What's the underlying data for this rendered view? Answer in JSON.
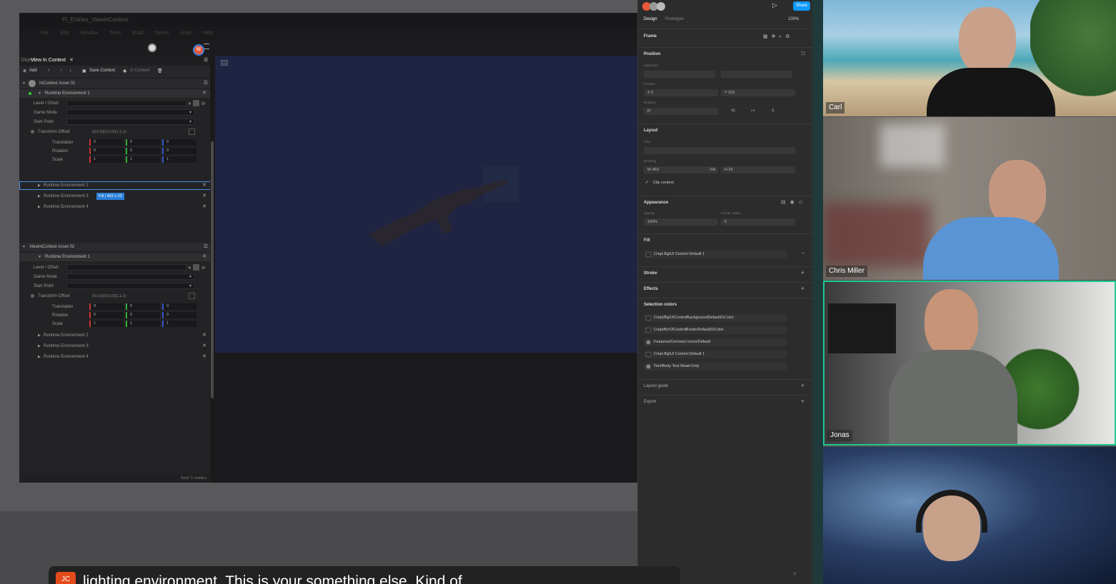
{
  "colors": {
    "accent": "#2a7fd8",
    "teal_border": "#1fc890",
    "figma_share": "#0d99ff",
    "caption_logo": "#e44a1a"
  },
  "editor": {
    "title": "FI_Entries_ViewInContext",
    "menu": "File Edit Window Tools Build Select Actor Help",
    "tab": {
      "left": "Object",
      "label": "View In Context"
    },
    "toolbar": {
      "add": "Add",
      "save": "Save Context",
      "incontext": "In Context"
    },
    "avatar_initial": "M",
    "assets": [
      {
        "name": "InContext Asset 01",
        "env1": "Runtime Environment 1",
        "fields": {
          "level": "Level / OSub",
          "game_mode": "Game Mode",
          "start_point": "Start Point",
          "transform": "Transform Offset",
          "transform_val": "(0,0,0)(0,0,0)(1,1,1)"
        },
        "translation": {
          "label": "Translation",
          "x": "0",
          "y": "0",
          "z": "0"
        },
        "rotation": {
          "label": "Rotation",
          "x": "0",
          "y": "0",
          "z": "0"
        },
        "scale": {
          "label": "Scale",
          "x": "1",
          "y": "1",
          "z": "1"
        },
        "envs": [
          "Runtime Environment 2",
          "Runtime Environment 3",
          "Runtime Environment 4"
        ],
        "tooltip": "Fill | 463 x 23"
      },
      {
        "name": "ViewInContext Asset 02",
        "env1": "Runtime Environment 1",
        "fields": {
          "level": "Level / OSub",
          "game_mode": "Game Mode",
          "start_point": "Start Point",
          "transform": "Transform Offset",
          "transform_val": "(0,0,0)(0,0,0)(1,1,1)"
        },
        "translation": {
          "label": "Translation",
          "x": "0",
          "y": "0",
          "z": "0"
        },
        "rotation": {
          "label": "Rotation",
          "x": "0",
          "y": "0",
          "z": "0"
        },
        "scale": {
          "label": "Scale",
          "x": "1",
          "y": "1",
          "z": "1"
        },
        "envs": [
          "Runtime Environment 2",
          "Runtime Environment 3",
          "Runtime Environment 4"
        ]
      }
    ],
    "footer": "Total: 5 entities"
  },
  "figma": {
    "share": "Share",
    "tabs": {
      "design": "Design",
      "prototype": "Prototype"
    },
    "zoom": "100%",
    "frame": "Frame",
    "position": {
      "title": "Position",
      "alignment": "Alignment",
      "pos_label": "Position",
      "x": "X  0",
      "y": "Y  210",
      "rotation_label": "Rotation",
      "rotation": "0°"
    },
    "layout": {
      "title": "Layout",
      "flow": "Flow",
      "resizing": "Resizing",
      "w": "W  463",
      "w_mode": "Fill",
      "h": "H  23",
      "clip": "Clip content"
    },
    "appearance": {
      "title": "Appearance",
      "opacity_label": "Opacity",
      "opacity": "100%",
      "radius_label": "Corner radius",
      "radius": "0"
    },
    "fill": {
      "title": "Fill",
      "value": "Cmpt Bg/UI Control Default 1"
    },
    "stroke": "Stroke",
    "effects": "Effects",
    "selection_colors": {
      "title": "Selection colors",
      "items": [
        "Cmpt/Bg/UIControlBackgroundDefault01Color",
        "Cmpt/Br/UIControlBorderDefault01Color",
        "Features/Common Icons/Default",
        "Cmpt Bg/UI Control Default 1",
        "Text/Body Text Read-Only"
      ]
    },
    "layout_guide": "Layout guide",
    "export": "Export",
    "help": "?"
  },
  "participants": [
    {
      "name": "Carl"
    },
    {
      "name": "Chris Miller"
    },
    {
      "name": "Jonas",
      "active": true
    },
    {
      "name": ""
    }
  ],
  "caption": {
    "logo": "JC",
    "text": "lighting environment. This is your something else. Kind of"
  }
}
